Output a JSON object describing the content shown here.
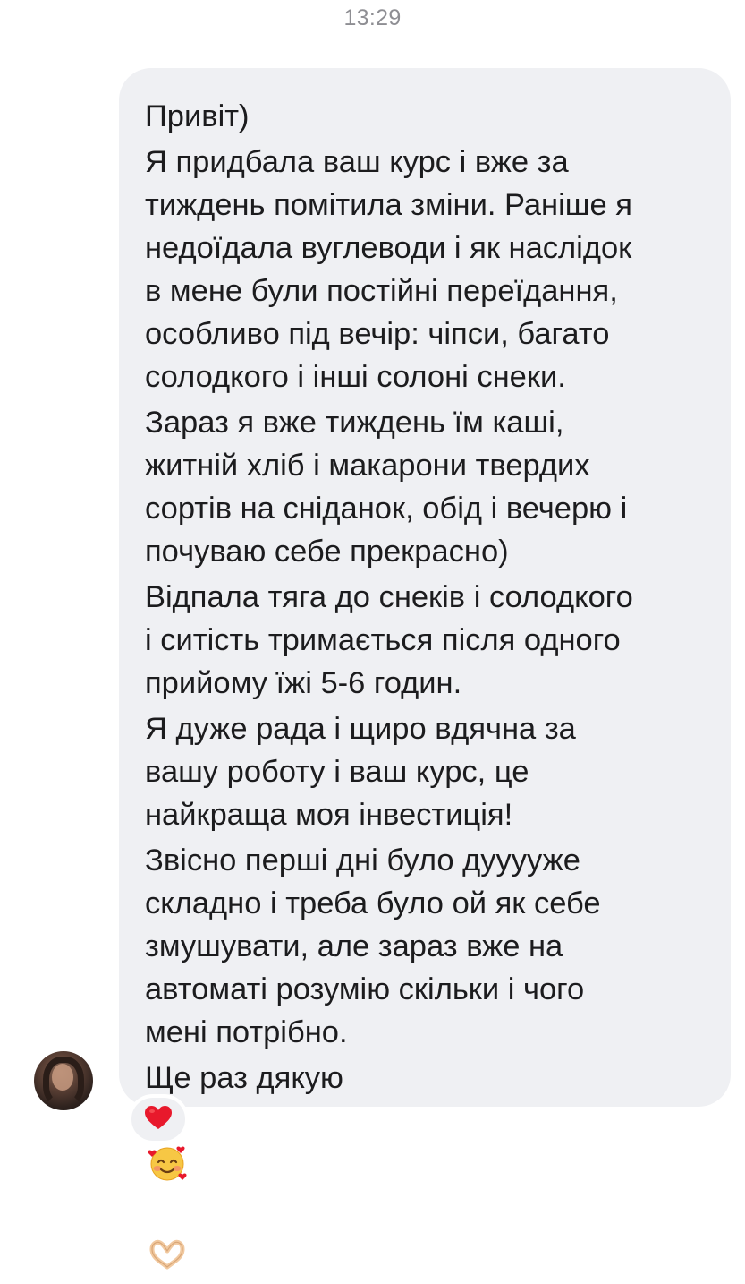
{
  "timestamp": "13:29",
  "message": {
    "paragraphs": [
      "Привіт)",
      "Я придбала ваш курс і вже за\nтиждень помітила зміни. Раніше я\nнедоїдала вуглеводи і як наслідок\nв мене були постійні переїдання,\nособливо під вечір: чіпси, багато\nсолодкого і інші солоні снеки.",
      "Зараз я вже тиждень їм каші,\nжитній хліб і макарони твердих\nсортів на сніданок, обід і вечерю і\nпочуваю себе прекрасно)",
      "Відпала тяга до снеків і солодкого\nі ситість тримається після одного\nприйому їжі 5-6 годин.",
      "Я дуже рада і щиро вдячна за\nвашу роботу і ваш курс, це\nнайкраща моя інвестиція!",
      "Звісно перші дні було дууууже\nскладно і треба було ой як себе\nзмушувати, але зараз вже на\nавтоматі розумію скільки і чого\nмені потрібно."
    ],
    "last_line": "Ще раз дякую",
    "last_line_emojis": [
      "smiling-face-with-hearts",
      "heart-hands"
    ]
  },
  "sender": {
    "avatar": "profile-photo"
  },
  "reaction": {
    "emoji": "red-heart",
    "color": "#e8192c"
  },
  "colors": {
    "bubble": "#eff0f3",
    "text": "#1c1c1e",
    "timestamp": "#8e8e93"
  }
}
